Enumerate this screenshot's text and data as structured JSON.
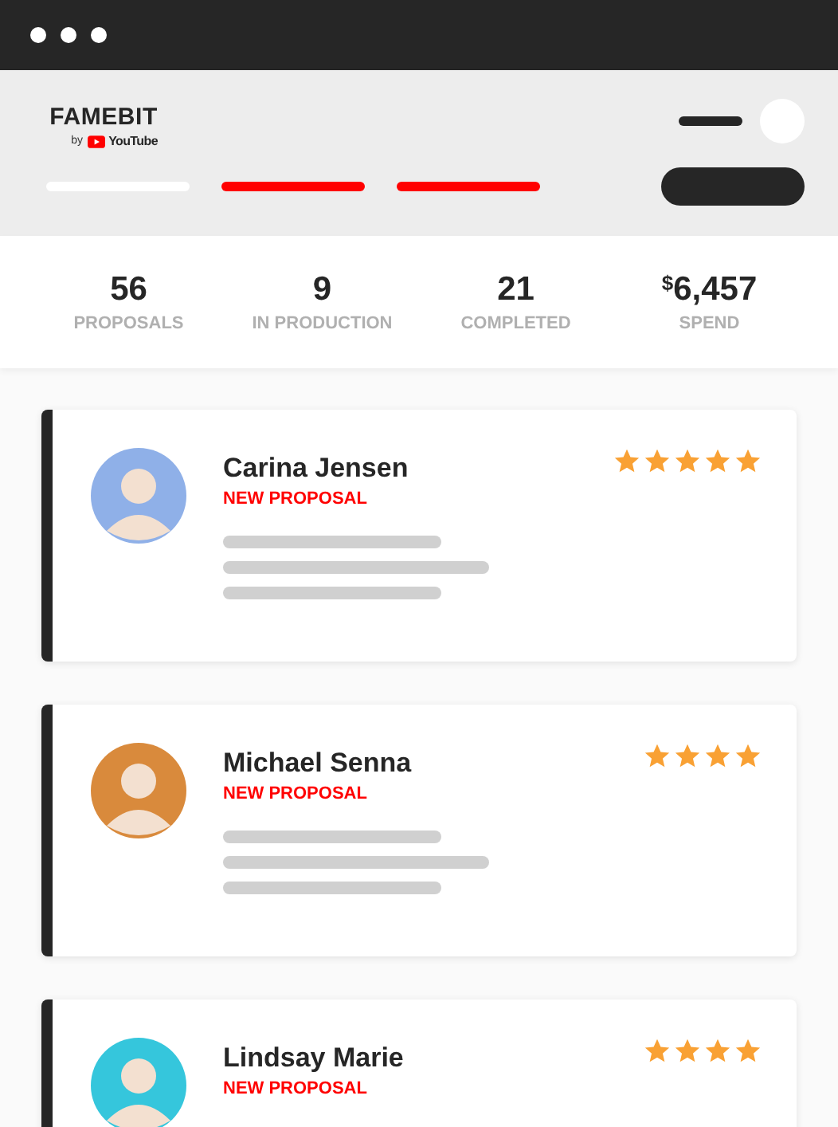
{
  "logo": {
    "name": "FAMEBIT",
    "by": "by",
    "brand": "YouTube"
  },
  "nav_bars": [
    {
      "selected": true
    },
    {
      "selected": false
    },
    {
      "selected": false
    }
  ],
  "stats": [
    {
      "value": "56",
      "label": "PROPOSALS"
    },
    {
      "value": "9",
      "label": "IN PRODUCTION"
    },
    {
      "value": "21",
      "label": "COMPLETED"
    },
    {
      "currency": "$",
      "value": "6,457",
      "label": "SPEND"
    }
  ],
  "proposals": [
    {
      "name": "Carina Jensen",
      "status": "NEW PROPOSAL",
      "stars": 5,
      "color": "#8fb0e8",
      "details": true
    },
    {
      "name": "Michael Senna",
      "status": "NEW PROPOSAL",
      "stars": 4,
      "color": "#d98a3c",
      "details": true
    },
    {
      "name": "Lindsay Marie",
      "status": "NEW PROPOSAL",
      "stars": 4,
      "color": "#35c6dc",
      "details": false
    }
  ]
}
